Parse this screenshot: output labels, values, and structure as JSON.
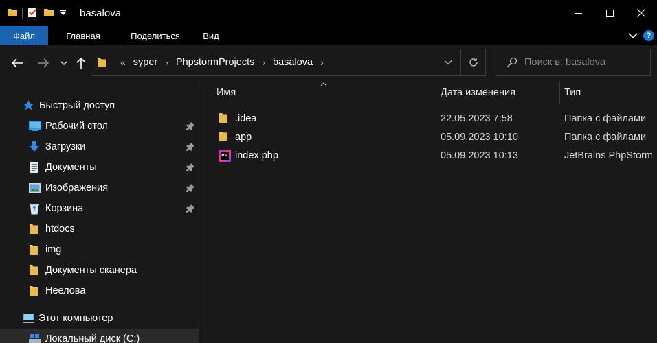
{
  "window": {
    "title": "basalova"
  },
  "ribbon": {
    "tabs": [
      "Файл",
      "Главная",
      "Поделиться",
      "Вид"
    ],
    "help_label": "?"
  },
  "address": {
    "overflow": "«",
    "crumbs": [
      "syper",
      "PhpstormProjects",
      "basalova"
    ]
  },
  "search": {
    "placeholder": "Поиск в: basalova"
  },
  "nav_pane": {
    "quick_access": "Быстрый доступ",
    "items": [
      {
        "label": "Рабочий стол",
        "icon": "desktop-icon",
        "pinned": true
      },
      {
        "label": "Загрузки",
        "icon": "downloads-icon",
        "pinned": true
      },
      {
        "label": "Документы",
        "icon": "documents-icon",
        "pinned": true
      },
      {
        "label": "Изображения",
        "icon": "pictures-icon",
        "pinned": true
      },
      {
        "label": "Корзина",
        "icon": "recycle-bin-icon",
        "pinned": true
      },
      {
        "label": "htdocs",
        "icon": "folder-icon",
        "pinned": false
      },
      {
        "label": "img",
        "icon": "folder-icon",
        "pinned": false
      },
      {
        "label": "Документы сканера",
        "icon": "folder-icon",
        "pinned": false
      },
      {
        "label": "Неелова",
        "icon": "folder-icon",
        "pinned": false
      }
    ],
    "this_pc": "Этот компьютер",
    "local_disk": "Локальный диск (C:)"
  },
  "file_list": {
    "columns": [
      "Имя",
      "Дата изменения",
      "Тип"
    ],
    "rows": [
      {
        "name": ".idea",
        "date": "22.05.2023 7:58",
        "type": "Папка с файлами",
        "icon": "folder-icon"
      },
      {
        "name": "app",
        "date": "05.09.2023 10:10",
        "type": "Папка с файлами",
        "icon": "folder-icon"
      },
      {
        "name": "index.php",
        "date": "05.09.2023 10:13",
        "type": "JetBrains PhpStorm",
        "icon": "phpstorm-file-icon"
      }
    ]
  },
  "colors": {
    "accent": "#1a63b3",
    "folder": "#f2c94c",
    "background": "#191919"
  }
}
